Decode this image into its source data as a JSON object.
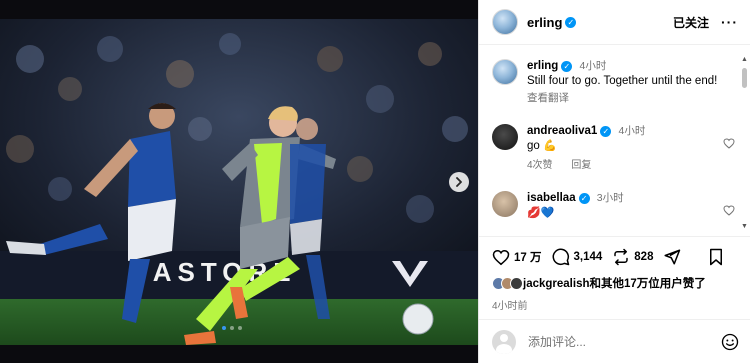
{
  "post": {
    "photo_alt_ad_text": "CASTORE",
    "carousel_dots": 3,
    "active_dot": 1
  },
  "header": {
    "username": "erling",
    "follow_state": "已关注",
    "more_label": "···"
  },
  "caption": {
    "username": "erling",
    "time": "4小时",
    "text": "Still four to go. Together until the end!",
    "translate": "查看翻译"
  },
  "comments": [
    {
      "username": "andreaoliva1",
      "time": "4小时",
      "text": "go",
      "emoji": "💪",
      "likes": "4次赞",
      "reply": "回复"
    },
    {
      "username": "isabellaa",
      "time": "3小时",
      "text": "",
      "emoji": "💋💙",
      "likes": "",
      "reply": ""
    }
  ],
  "actions": {
    "likes_count": "17 万",
    "comments_count": "3,144",
    "reposts_count": "828"
  },
  "likes_line": {
    "text": "jackgrealish和其他17万位用户赞了"
  },
  "time_ago": "4小时前",
  "add_comment": {
    "placeholder": "添加评论..."
  },
  "colors": {
    "verified": "#0095f6",
    "everton_blue": "#1f4fa8",
    "kit_neon": "#b7f542"
  }
}
